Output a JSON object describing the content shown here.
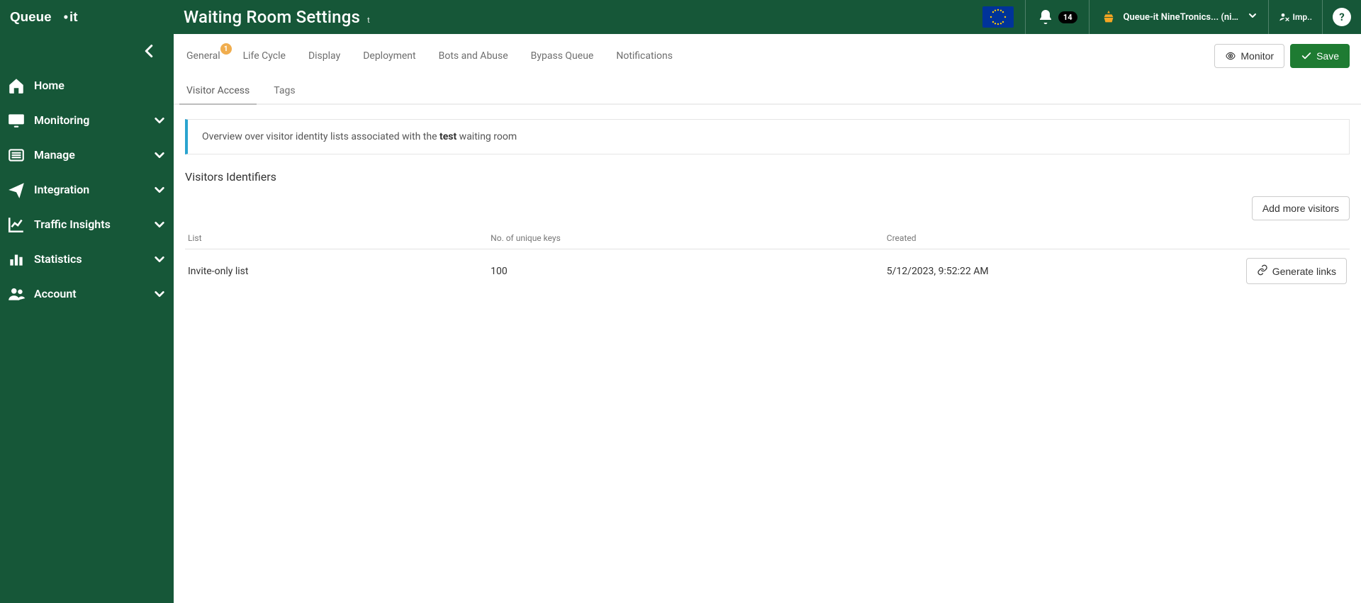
{
  "brand": "Queue-it",
  "header": {
    "title": "Waiting Room Settings",
    "subtitle": "t",
    "notifications_count": "14",
    "tenant_name": "Queue-it NineTronics... (nin...",
    "impersonate_label": "Imp..",
    "help_label": "?"
  },
  "sidebar": {
    "items": [
      {
        "label": "Home",
        "icon": "home",
        "expandable": false
      },
      {
        "label": "Monitoring",
        "icon": "monitor",
        "expandable": true
      },
      {
        "label": "Manage",
        "icon": "list",
        "expandable": true
      },
      {
        "label": "Integration",
        "icon": "send",
        "expandable": true
      },
      {
        "label": "Traffic Insights",
        "icon": "chart-line",
        "expandable": true
      },
      {
        "label": "Statistics",
        "icon": "bars",
        "expandable": true
      },
      {
        "label": "Account",
        "icon": "users",
        "expandable": true
      }
    ]
  },
  "tabs": {
    "primary": [
      {
        "label": "General",
        "badge": "1"
      },
      {
        "label": "Life Cycle"
      },
      {
        "label": "Display"
      },
      {
        "label": "Deployment"
      },
      {
        "label": "Bots and Abuse"
      },
      {
        "label": "Bypass Queue"
      },
      {
        "label": "Notifications"
      }
    ],
    "secondary": [
      {
        "label": "Visitor Access",
        "active": true
      },
      {
        "label": "Tags",
        "active": false
      }
    ]
  },
  "actions": {
    "monitor": "Monitor",
    "save": "Save"
  },
  "info": {
    "prefix": "Overview over visitor identity lists associated with the ",
    "bold": "test",
    "suffix": " waiting room"
  },
  "section": {
    "title": "Visitors Identifiers",
    "add_button": "Add more visitors",
    "columns": {
      "list": "List",
      "keys": "No. of unique keys",
      "created": "Created"
    },
    "rows": [
      {
        "name": "Invite-only list",
        "keys": "100",
        "created": "5/12/2023, 9:52:22 AM",
        "action": "Generate links"
      }
    ]
  }
}
